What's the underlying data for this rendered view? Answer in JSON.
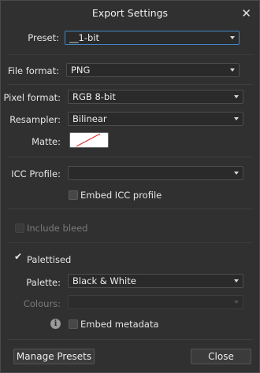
{
  "window": {
    "title": "Export Settings",
    "close_glyph": "✕"
  },
  "preset": {
    "label": "Preset:",
    "value": "__1-bit"
  },
  "file_format": {
    "label": "File format:",
    "value": "PNG"
  },
  "pixel_format": {
    "label": "Pixel format:",
    "value": "RGB 8-bit"
  },
  "resampler": {
    "label": "Resampler:",
    "value": "Bilinear"
  },
  "matte": {
    "label": "Matte:",
    "color": "#ffffff",
    "slash_color": "#e03030"
  },
  "icc_profile": {
    "label": "ICC Profile:",
    "value": ""
  },
  "embed_icc": {
    "label": "Embed ICC profile",
    "checked": false
  },
  "include_bleed": {
    "label": "Include bleed",
    "checked": false,
    "enabled": false
  },
  "palettised": {
    "label": "Palettised",
    "checked": true
  },
  "palette": {
    "label": "Palette:",
    "value": "Black & White"
  },
  "colours": {
    "label": "Colours:",
    "value": "",
    "enabled": false
  },
  "embed_metadata": {
    "label": "Embed metadata",
    "checked": false,
    "info_glyph": "i"
  },
  "footer": {
    "manage_presets": "Manage Presets",
    "close": "Close"
  },
  "colors": {
    "background": "#303030",
    "focus_border": "#3f86c6",
    "control_bg": "#2a2a2a"
  }
}
